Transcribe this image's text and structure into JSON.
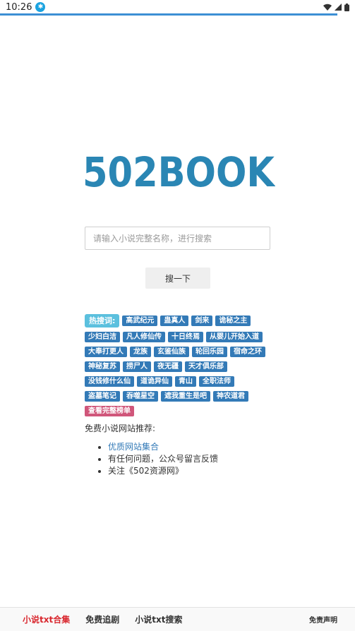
{
  "status": {
    "time": "10:26"
  },
  "logo": {
    "text": "502BOOK",
    "color": "#2a86b4"
  },
  "search": {
    "placeholder": "请输入小说完整名称，进行搜索",
    "value": "",
    "button_label": "搜一下"
  },
  "hot": {
    "label": "热搜词:",
    "tags": [
      "高武纪元",
      "蛊真人",
      "剑来",
      "诡秘之主",
      "少妇白洁",
      "凡人修仙传",
      "十日终焉",
      "从婴儿开始入道",
      "大奉打更人",
      "龙族",
      "玄鉴仙族",
      "轮回乐园",
      "宿命之环",
      "神秘复苏",
      "捞尸人",
      "夜无疆",
      "天才俱乐部",
      "没钱修什么仙",
      "道诡异仙",
      "青山",
      "全职法师",
      "盗墓笔记",
      "吞噬星空",
      "遮我重生是吧",
      "神农道君"
    ],
    "full_list_label": "查看完整榜单"
  },
  "recommend": {
    "title": "免费小说网站推荐:",
    "items": [
      "优质网站集合",
      "有任何问题，公众号留言反馈",
      "关注《502资源网》"
    ]
  },
  "bottom": {
    "nav": [
      "小说txt合集",
      "免费追剧",
      "小说txt搜索"
    ],
    "disclaimer": "免责声明"
  }
}
